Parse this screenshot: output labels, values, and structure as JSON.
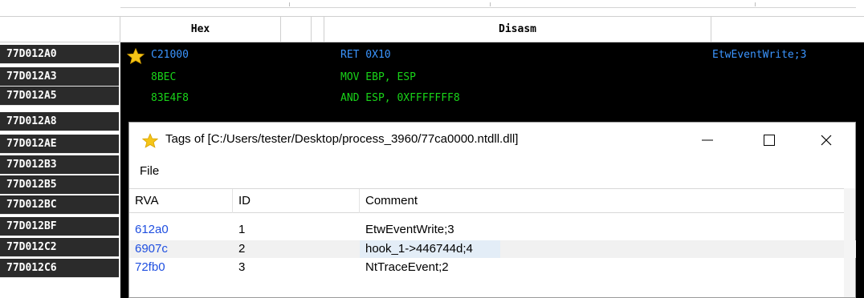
{
  "header": {
    "hex_label": "Hex",
    "disasm_label": "Disasm"
  },
  "addresses": [
    "77D012A0",
    "77D012A3",
    "77D012A5",
    "77D012A8",
    "77D012AE",
    "77D012B3",
    "77D012B5",
    "77D012BC",
    "77D012BF",
    "77D012C2",
    "77D012C6"
  ],
  "code_rows": [
    {
      "hex": "C21000",
      "disasm": "RET 0X10",
      "comment": "EtwEventWrite;3",
      "hex_color": "#3b95ff",
      "disasm_color": "#3b95ff",
      "comment_color": "#3b95ff"
    },
    {
      "hex": "8BEC",
      "disasm": "MOV EBP, ESP",
      "comment": "",
      "hex_color": "#19d419",
      "disasm_color": "#19d419",
      "comment_color": "#19d419"
    },
    {
      "hex": "83E4F8",
      "disasm": "AND ESP, 0XFFFFFFF8",
      "comment": "",
      "hex_color": "#19d419",
      "disasm_color": "#19d419",
      "comment_color": "#19d419"
    }
  ],
  "dialog": {
    "title": "Tags of [C:/Users/tester/Desktop/process_3960/77ca0000.ntdll.dll]",
    "menu_file": "File",
    "columns": [
      "RVA",
      "ID",
      "Comment"
    ],
    "rows": [
      {
        "rva": "612a0",
        "id": "1",
        "comment": "EtwEventWrite;3"
      },
      {
        "rva": "6907c",
        "id": "2",
        "comment": "hook_1->446744d;4"
      },
      {
        "rva": "72fb0",
        "id": "3",
        "comment": "NtTraceEvent;2"
      }
    ],
    "rva_color": "#1f4fe0",
    "highlight_color": "#e3edf7"
  },
  "icons": {
    "star": "star-icon",
    "minimize": "minimize-icon",
    "maximize": "maximize-icon",
    "close": "close-icon"
  },
  "colors": {
    "address_bg": "#2b2b2b",
    "code_bg": "#000000",
    "star_fill": "#f5c518"
  }
}
